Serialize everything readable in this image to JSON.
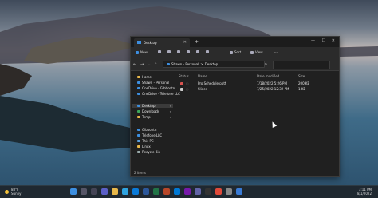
{
  "colors": {
    "accent": "#3d8fe0",
    "folder": "#e8b84a",
    "window_bg": "#202020",
    "taskbar_bg": "#1f2830"
  },
  "window": {
    "tab_title": "Desktop",
    "new_tab": "+",
    "min": "—",
    "max": "☐",
    "close": "✕",
    "tab_close": "✕"
  },
  "commands": {
    "new": "New",
    "sort": "Sort",
    "view": "View",
    "more": "···"
  },
  "address": {
    "parts": [
      "Shawn - Personal",
      "Desktop"
    ],
    "sep": ">",
    "refresh": "↻"
  },
  "sidebar": {
    "items": [
      {
        "label": "Home",
        "icon": "home-icon"
      },
      {
        "label": "Shawn - Personal",
        "icon": "onedrive-icon"
      },
      {
        "label": "OneDrive - Gibbontn",
        "icon": "onedrive-icon"
      },
      {
        "label": "OneDrive - Telefone LLC",
        "icon": "onedrive-icon"
      },
      {
        "label": "Desktop",
        "icon": "desktop-icon",
        "selected": true,
        "pinned": true
      },
      {
        "label": "Downloads",
        "icon": "download-icon",
        "pinned": true
      },
      {
        "label": "Temp",
        "icon": "folder-icon",
        "pinned": true
      },
      {
        "label": "Gibbontn",
        "icon": "folder-icon"
      },
      {
        "label": "Telefone LLC",
        "icon": "folder-icon"
      },
      {
        "label": "This PC",
        "icon": "pc-icon"
      },
      {
        "label": "Linux",
        "icon": "linux-icon"
      },
      {
        "label": "Recycle Bin",
        "icon": "recycle-icon"
      }
    ]
  },
  "columns": {
    "status": "Status",
    "name": "Name",
    "date": "Date modified",
    "size": "Size"
  },
  "files": [
    {
      "name": "Pro Schedule.pptf",
      "date": "7/18/2022 5:26 PM",
      "size": "200 KB",
      "icon": "pdf-icon"
    },
    {
      "name": "Slides",
      "date": "7/25/2022 12:32 PM",
      "size": "1 KB",
      "icon": "file-icon"
    }
  ],
  "statusbar": {
    "items": "2 items"
  },
  "taskbar": {
    "temp": "88°F",
    "cond": "Sunny",
    "time": "3:11 PM",
    "date": "8/1/2022"
  }
}
